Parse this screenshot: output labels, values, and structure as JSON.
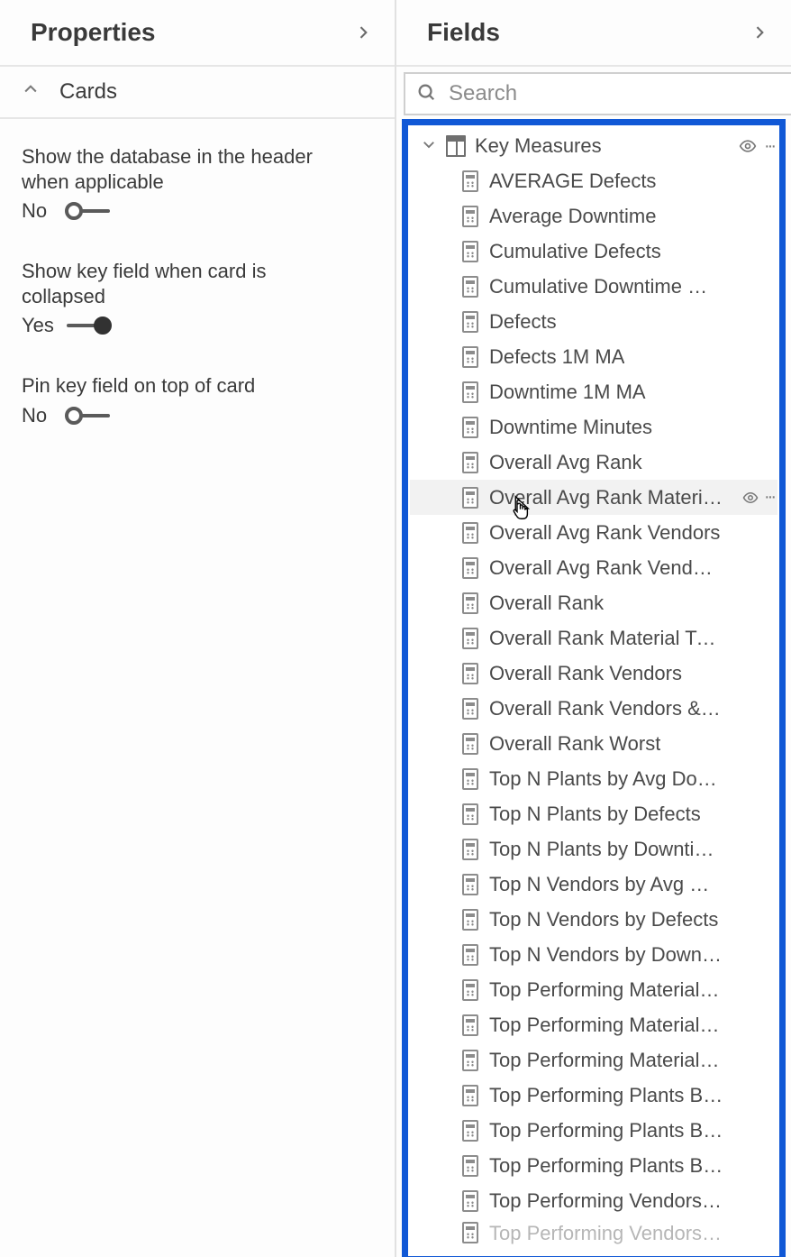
{
  "properties": {
    "title": "Properties",
    "section": "Cards",
    "items": [
      {
        "label": "Show the database in the header when applicable",
        "state": "No",
        "on": false
      },
      {
        "label": "Show key field when card is collapsed",
        "state": "Yes",
        "on": true
      },
      {
        "label": "Pin key field on top of card",
        "state": "No",
        "on": false
      }
    ]
  },
  "fields": {
    "title": "Fields",
    "search_placeholder": "Search",
    "table": "Key Measures",
    "hoveredIndex": 9,
    "measures": [
      "AVERAGE Defects",
      "Average Downtime",
      "Cumulative Defects",
      "Cumulative Downtime Minutes",
      "Defects",
      "Defects 1M MA",
      "Downtime 1M MA",
      "Downtime Minutes",
      "Overall Avg Rank",
      "Overall Avg Rank Material Type",
      "Overall Avg Rank Vendors",
      "Overall Avg Rank Vendors Pla...",
      "Overall Rank",
      "Overall Rank Material Type",
      "Overall Rank Vendors",
      "Overall Rank Vendors & Plants",
      "Overall Rank Worst",
      "Top N Plants by Avg Downtim...",
      "Top N Plants by Defects",
      "Top N Plants by Downtime Mi...",
      "Top N Vendors by Avg Downt...",
      "Top N Vendors by Defects",
      "Top N Vendors by Downtime ...",
      "Top Performing Material Type...",
      "Top Performing Material Type...",
      "Top Performing Material Type...",
      "Top Performing Plants By Avg...",
      "Top Performing Plants By Def...",
      "Top Performing Plants By Do...",
      "Top Performing Vendors & Pl..."
    ],
    "partial_row": "Top Performing Vendors & Pl..."
  }
}
